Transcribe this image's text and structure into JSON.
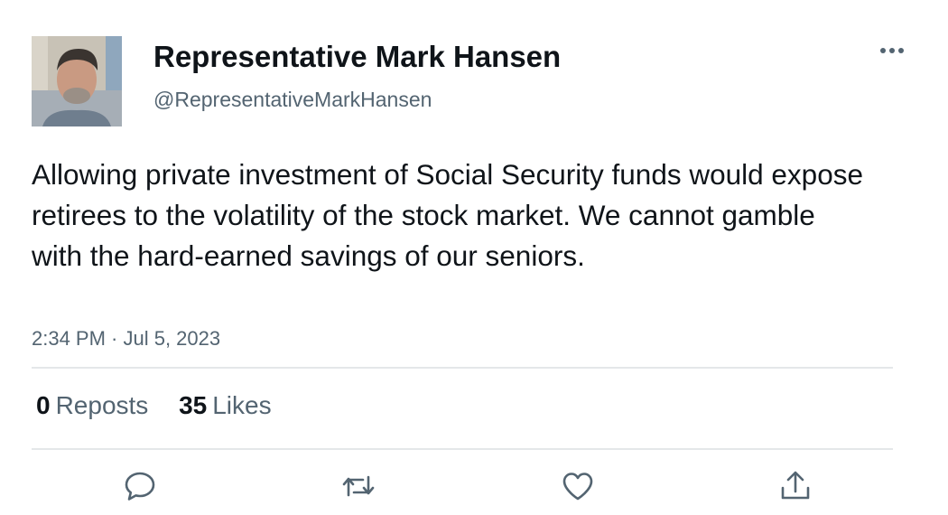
{
  "author": {
    "display_name": "Representative Mark Hansen",
    "handle": "@RepresentativeMarkHansen",
    "avatar_icon": "profile-photo"
  },
  "tweet": {
    "text": "Allowing private investment of Social Security funds would expose retirees to the volatility of the stock market. We cannot gamble with the hard-earned savings of our seniors.",
    "timestamp": "2:34 PM · Jul 5, 2023"
  },
  "stats": {
    "reposts_count": "0",
    "reposts_label": "Reposts",
    "likes_count": "35",
    "likes_label": "Likes"
  },
  "actions": {
    "reply_icon": "reply-icon",
    "repost_icon": "repost-icon",
    "like_icon": "like-icon",
    "share_icon": "share-icon",
    "more_icon": "more-options-icon"
  },
  "colors": {
    "primary_text": "#0f1419",
    "secondary_text": "#536471",
    "divider": "#e4e7e9",
    "icon": "#536471"
  }
}
